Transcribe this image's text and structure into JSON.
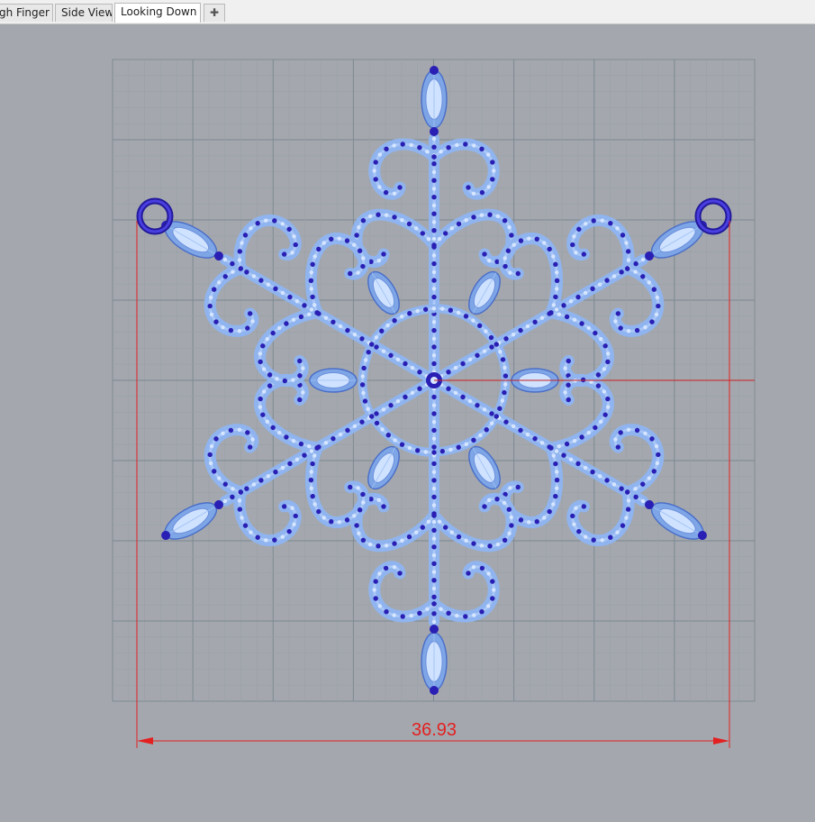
{
  "tabs": [
    {
      "label": "gh Finger",
      "active": false
    },
    {
      "label": "Side View",
      "active": false
    },
    {
      "label": "Looking Down",
      "active": true
    },
    {
      "label": "+",
      "icon": "add-tab-icon"
    }
  ],
  "viewport": {
    "name": "Looking Down",
    "background": "#a4a8ae",
    "grid_color": "#7f8a92",
    "model_color": "#8fb4ef",
    "bead_color": "#2a1fb4",
    "dimension": {
      "value": "36.93",
      "color": "#e32020"
    }
  }
}
